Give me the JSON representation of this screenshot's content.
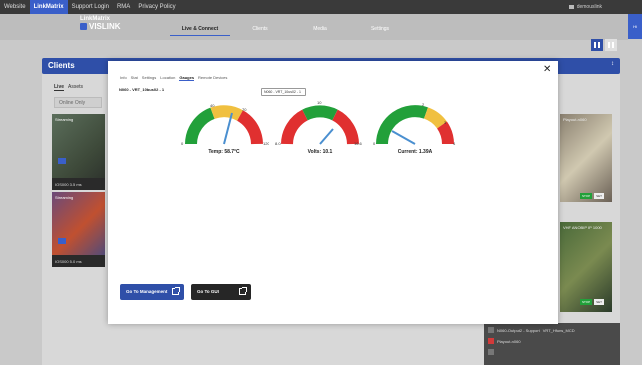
{
  "topnav": {
    "items": [
      "Website",
      "LinkMatrix",
      "Support Login",
      "RMA",
      "Privacy Policy"
    ],
    "user": "demouslink",
    "hi_tab": "Hi"
  },
  "logo": {
    "line1": "LinkMatrix",
    "line2": "VISLINK"
  },
  "mainnav": [
    "Live & Connect",
    "Clients",
    "Media",
    "Settings"
  ],
  "clients_panel": {
    "title": "Clients",
    "tabs": [
      "Live",
      "Assets"
    ],
    "filter": "Online Only",
    "tiles": [
      {
        "tag": "Streaming",
        "footer": "IOS000    3.5 ms"
      },
      {
        "tag": "Streaming",
        "footer": "IOS000    5.0 ms"
      }
    ],
    "right_tiles": [
      {
        "label": "Playout-n060",
        "stop": "STOP",
        "set": "SET"
      },
      {
        "label": "VHF ANOBIP IP 1000",
        "stop": "STOP",
        "set": "SET"
      }
    ],
    "bottom_card": {
      "name": "N060-Output2 - Support",
      "sub": "Playout-n060",
      "extra": "VRT_Hfuns_MCD"
    }
  },
  "modal": {
    "tabs": [
      "Info",
      "Stat",
      "Settings",
      "Location",
      "Gauges",
      "Remote Devices"
    ],
    "active_tab": "Gauges",
    "device_name": "N060 - VRT_10bus02 - 1",
    "device_select": "N060 - VRT_10us02 - 1",
    "gauges": [
      {
        "label": "Temp: 58.7°C",
        "value": 58.7,
        "ticks": [
          "0",
          "40",
          "70",
          "90",
          "120"
        ]
      },
      {
        "label": "Volts: 10.1",
        "value": 10.1,
        "ticks": [
          "8.0",
          "10",
          "14",
          "16.6"
        ]
      },
      {
        "label": "Current: 1.39A",
        "value": 1.39,
        "ticks": [
          "0",
          "2",
          "3",
          "4"
        ]
      }
    ],
    "buttons": {
      "management": "Go To Management",
      "gui": "Go To GUI"
    }
  },
  "colors": {
    "accent": "#2f4fa8",
    "green": "#22a03a",
    "yellow": "#f0c040",
    "red": "#e03030"
  }
}
